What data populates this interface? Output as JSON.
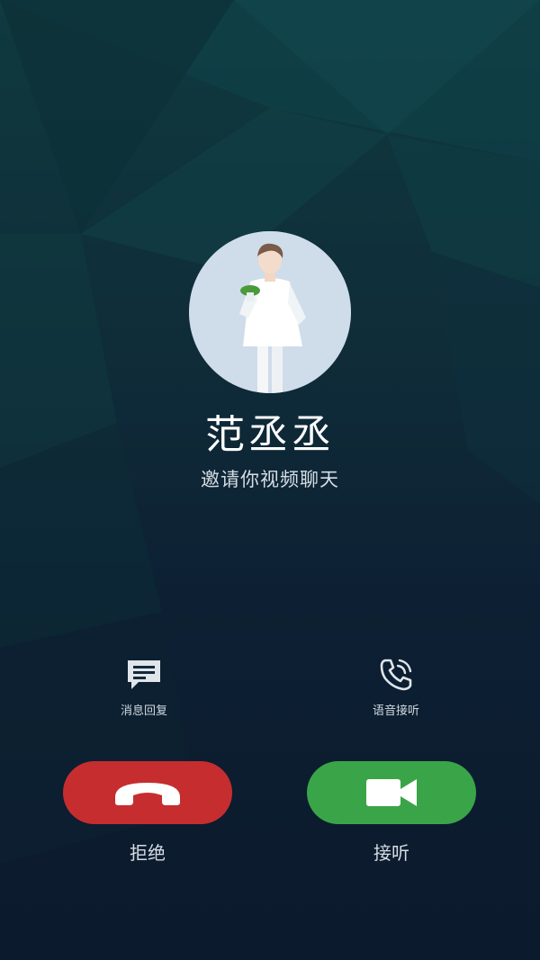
{
  "caller": {
    "name": "范丞丞",
    "call_type": "邀请你视频聊天"
  },
  "aux_actions": {
    "message_reply": {
      "label": "消息回复",
      "icon": "message-reply-icon"
    },
    "voice_answer": {
      "label": "语音接听",
      "icon": "voice-answer-icon"
    }
  },
  "buttons": {
    "decline": {
      "label": "拒绝",
      "icon": "phone-hangup-icon",
      "color": "#c62d2f"
    },
    "accept": {
      "label": "接听",
      "icon": "video-camera-icon",
      "color": "#3aa548"
    }
  },
  "colors": {
    "background_top": "#0f3a3f",
    "background_bottom": "#0b1a2c",
    "text_primary": "#ffffff"
  }
}
